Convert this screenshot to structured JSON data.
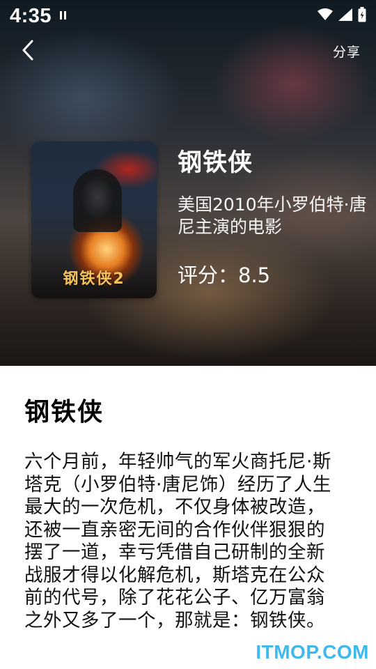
{
  "status_bar": {
    "time": "4:35",
    "icons": [
      "wifi-icon",
      "signal-icon",
      "battery-icon"
    ]
  },
  "header": {
    "back_icon": "chevron-left-icon",
    "share_label": "分享"
  },
  "movie": {
    "poster_text": "钢铁侠2",
    "title": "钢铁侠",
    "subtitle": "美国2010年小罗伯特·唐尼主演的电影",
    "rating": "评分：8.5"
  },
  "detail": {
    "title": "钢铁侠",
    "body": "六个月前，年轻帅气的军火商托尼·斯塔克（小罗伯特·唐尼饰）经历了人生最大的一次危机，不仅身体被改造，还被一直亲密无间的合作伙伴狠狠的摆了一道，幸亏凭借自己研制的全新战服才得以化解危机，斯塔克在公众前的代号，除了花花公子、亿万富翁之外又多了一个，那就是：钢铁侠。"
  },
  "watermark": "ITMOP.COM",
  "colors": {
    "watermark": "#3fb8ec",
    "text_dark": "#111111",
    "text_light": "#ffffff"
  }
}
